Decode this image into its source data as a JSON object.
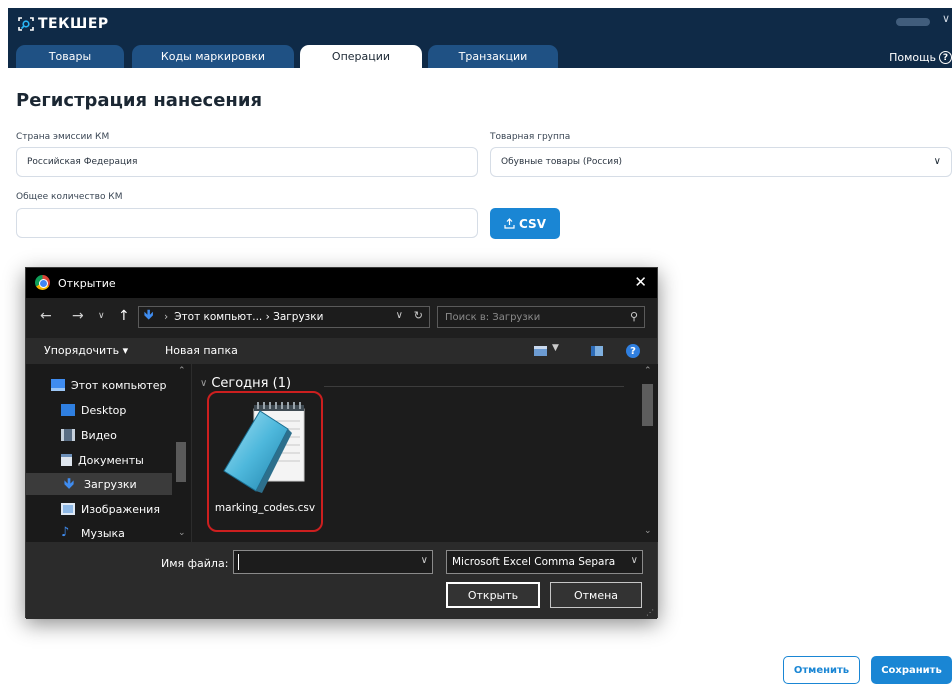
{
  "app": {
    "logo_text": "ТЕКШЕР",
    "colors": {
      "header_bg": "#0f2a47",
      "tab_bg": "#1f5184",
      "accent": "#1a86d4"
    }
  },
  "tabs": [
    {
      "label": "Товары",
      "active": false
    },
    {
      "label": "Коды маркировки",
      "active": false
    },
    {
      "label": "Операции",
      "active": true
    },
    {
      "label": "Транзакции",
      "active": false
    }
  ],
  "header": {
    "help_label": "Помощь",
    "help_icon": "question-circle-icon"
  },
  "page": {
    "title": "Регистрация нанесения",
    "country_label": "Страна эмиссии КМ",
    "country_value": "Российская Федерация",
    "group_label": "Товарная группа",
    "group_value": "Обувные товары (Россия)",
    "quantity_label": "Общее количество КМ",
    "quantity_value": "",
    "csv_button": "CSV",
    "cancel_button": "Отменить",
    "save_button": "Сохранить"
  },
  "dialog": {
    "title": "Открытие",
    "path": "Этот компьют...  ›  Загрузки",
    "search_placeholder": "Поиск в: Загрузки",
    "organize_label": "Упорядочить ▾",
    "new_folder_label": "Новая папка",
    "nav_items": [
      {
        "label": "Этот компьютер",
        "icon": "computer-icon"
      },
      {
        "label": "Desktop",
        "icon": "desktop-folder-icon"
      },
      {
        "label": "Видео",
        "icon": "video-folder-icon"
      },
      {
        "label": "Документы",
        "icon": "documents-folder-icon"
      },
      {
        "label": "Загрузки",
        "icon": "downloads-folder-icon",
        "selected": true
      },
      {
        "label": "Изображения",
        "icon": "pictures-folder-icon"
      },
      {
        "label": "Музыка",
        "icon": "music-folder-icon"
      }
    ],
    "group_header": "Сегодня (1)",
    "file_name": "marking_codes.csv",
    "filename_label": "Имя файла:",
    "filename_value": "",
    "filetype_value": "Microsoft Excel Comma Separa",
    "open_button": "Открыть",
    "cancel_button": "Отмена"
  }
}
